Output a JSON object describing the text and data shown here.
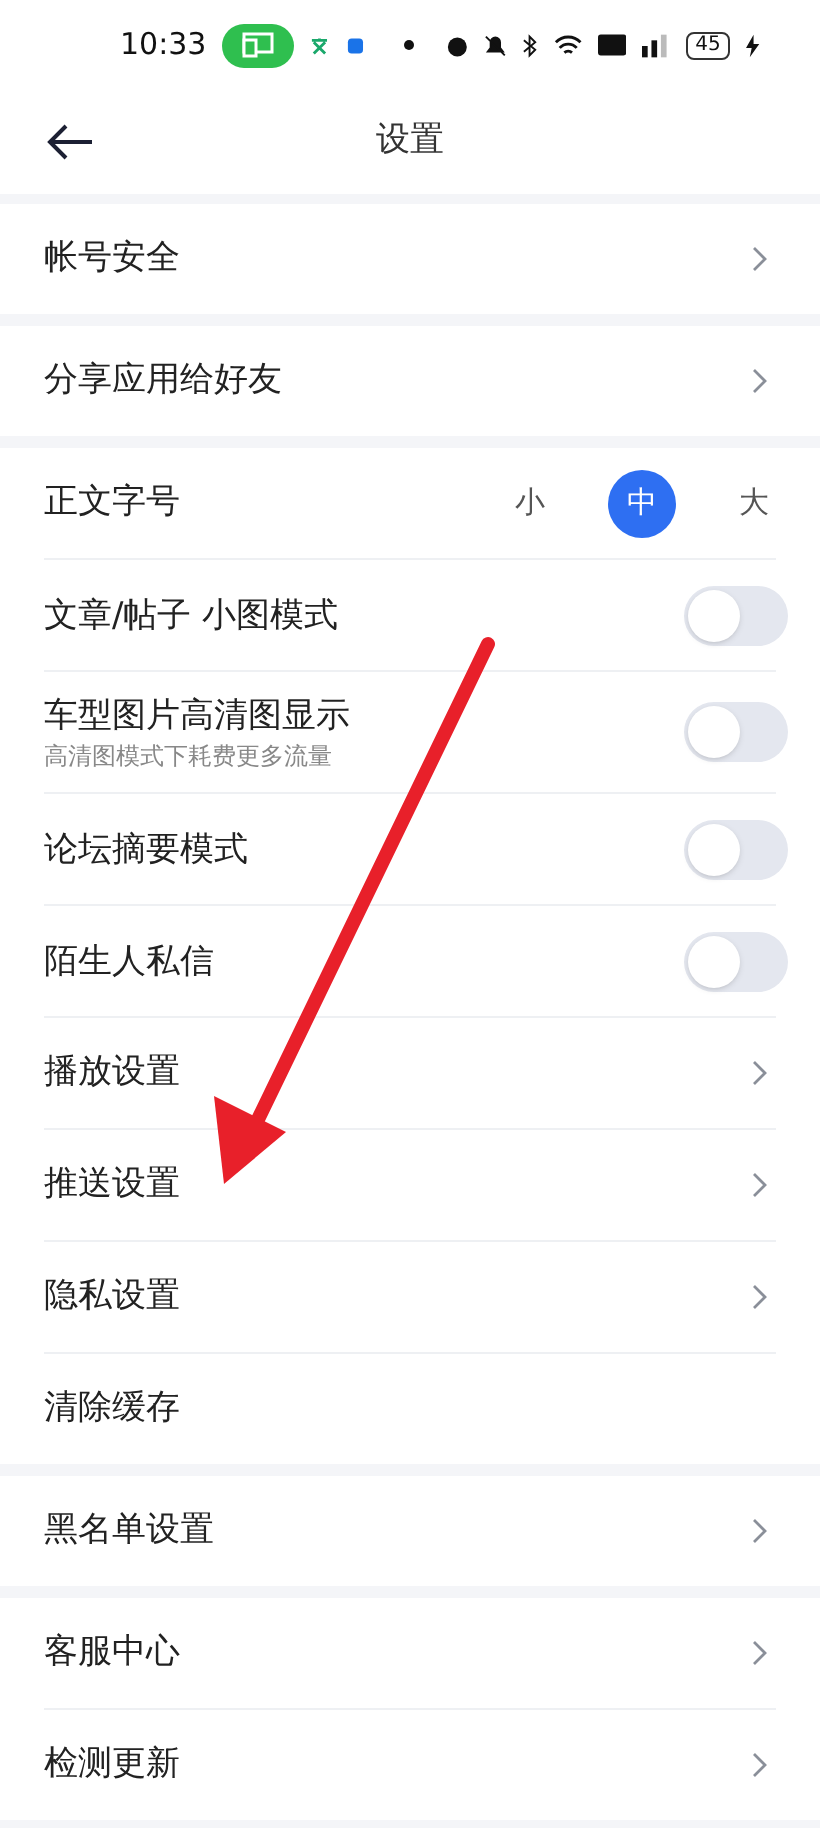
{
  "status_bar": {
    "time": "10:33",
    "battery": "45"
  },
  "header": {
    "title": "设置"
  },
  "groups": [
    {
      "items": [
        {
          "kind": "link",
          "label": "帐号安全"
        }
      ]
    },
    {
      "items": [
        {
          "kind": "link",
          "label": "分享应用给好友"
        }
      ]
    },
    {
      "items": [
        {
          "kind": "size",
          "label": "正文字号",
          "options": [
            {
              "label": "小",
              "selected": false
            },
            {
              "label": "中",
              "selected": true
            },
            {
              "label": "大",
              "selected": false
            }
          ]
        },
        {
          "kind": "toggle",
          "label": "文章/帖子 小图模式",
          "on": false
        },
        {
          "kind": "toggle",
          "label": "车型图片高清图显示",
          "hint": "高清图模式下耗费更多流量",
          "on": false
        },
        {
          "kind": "toggle",
          "label": "论坛摘要模式",
          "on": false
        },
        {
          "kind": "toggle",
          "label": "陌生人私信",
          "on": false
        },
        {
          "kind": "link",
          "label": "播放设置"
        },
        {
          "kind": "link",
          "label": "推送设置"
        },
        {
          "kind": "link",
          "label": "隐私设置"
        },
        {
          "kind": "plain",
          "label": "清除缓存"
        }
      ]
    },
    {
      "items": [
        {
          "kind": "link",
          "label": "黑名单设置"
        }
      ]
    },
    {
      "items": [
        {
          "kind": "link",
          "label": "客服中心"
        },
        {
          "kind": "link",
          "label": "检测更新"
        }
      ]
    }
  ]
}
